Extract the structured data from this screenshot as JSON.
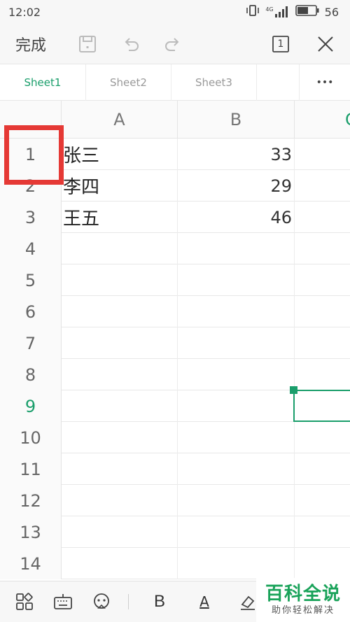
{
  "status": {
    "time": "12:02",
    "network": "4G",
    "battery": "56"
  },
  "toolbar": {
    "done_label": "完成",
    "pages_count": "1"
  },
  "tabs": [
    {
      "label": "Sheet1",
      "active": true
    },
    {
      "label": "Sheet2",
      "active": false
    },
    {
      "label": "Sheet3",
      "active": false
    },
    {
      "label": "",
      "active": false
    }
  ],
  "more_label": "•••",
  "columns": [
    "A",
    "B",
    "C"
  ],
  "rows": [
    {
      "num": "1",
      "a": "张三",
      "b": "33"
    },
    {
      "num": "2",
      "a": "李四",
      "b": "29"
    },
    {
      "num": "3",
      "a": "王五",
      "b": "46"
    },
    {
      "num": "4",
      "a": "",
      "b": ""
    },
    {
      "num": "5",
      "a": "",
      "b": ""
    },
    {
      "num": "6",
      "a": "",
      "b": ""
    },
    {
      "num": "7",
      "a": "",
      "b": ""
    },
    {
      "num": "8",
      "a": "",
      "b": ""
    },
    {
      "num": "9",
      "a": "",
      "b": ""
    },
    {
      "num": "10",
      "a": "",
      "b": ""
    },
    {
      "num": "11",
      "a": "",
      "b": ""
    },
    {
      "num": "12",
      "a": "",
      "b": ""
    },
    {
      "num": "13",
      "a": "",
      "b": ""
    },
    {
      "num": "14",
      "a": "",
      "b": ""
    }
  ],
  "selected_row": "9",
  "bottom": {
    "bold_label": "B",
    "font_color_label": "A"
  },
  "watermark": {
    "title": "百科全说",
    "subtitle": "助你轻松解决"
  },
  "colors": {
    "accent": "#1a9e6b",
    "highlight": "#e53935"
  }
}
